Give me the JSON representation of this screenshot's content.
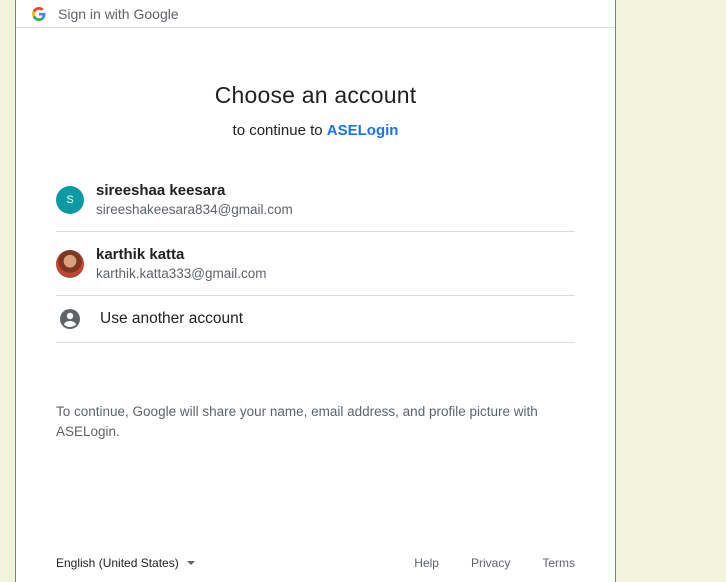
{
  "header": {
    "title": "Sign in with Google"
  },
  "main": {
    "heading": "Choose an account",
    "subtitle_prefix": "to continue to",
    "app_name": "ASELogin"
  },
  "accounts": [
    {
      "initial": "S",
      "name": "sireeshaa keesara",
      "email": "sireeshakeesara834@gmail.com",
      "avatar_color": "#0b9aa3"
    },
    {
      "name": "karthik katta",
      "email": "karthik.katta333@gmail.com",
      "avatar": "profile-photo"
    }
  ],
  "another_account": {
    "label": "Use another account",
    "icon": "account-circle-icon"
  },
  "disclaimer": "To continue, Google will share your name, email address, and profile picture with ASELogin.",
  "footer": {
    "language": "English (United States)",
    "help": "Help",
    "privacy": "Privacy",
    "terms": "Terms"
  },
  "colors": {
    "accent": "#1a73e8",
    "background": "#f3f2dc",
    "window_border": "#4a90c8"
  }
}
